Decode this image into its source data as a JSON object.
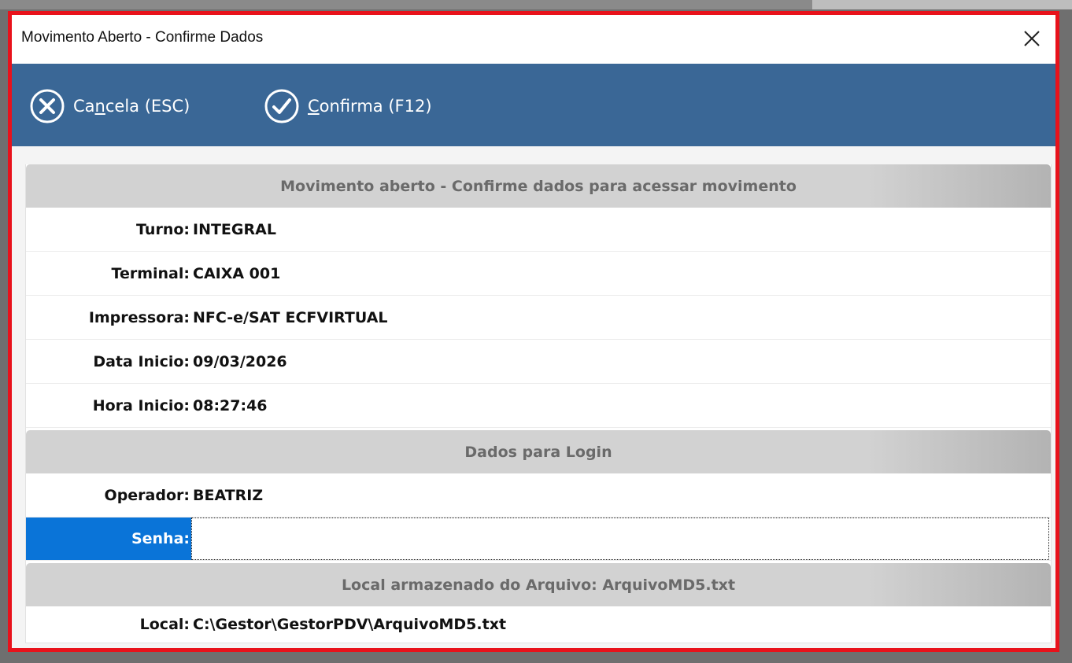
{
  "window": {
    "title": "Movimento Aberto - Confirme Dados"
  },
  "toolbar": {
    "cancel": {
      "label_pre": "Ca",
      "label_key": "n",
      "label_post": "cela (ESC)",
      "icon": "cancel-circle-icon"
    },
    "confirm": {
      "label_pre": "",
      "label_key": "C",
      "label_post": "onfirma (F12)",
      "icon": "check-circle-icon"
    }
  },
  "section_movimento": {
    "title": "Movimento aberto - Confirme dados para acessar movimento",
    "rows": [
      {
        "label": "Turno:",
        "value": "INTEGRAL"
      },
      {
        "label": "Terminal:",
        "value": "CAIXA 001"
      },
      {
        "label": "Impressora:",
        "value": "NFC-e/SAT ECFVIRTUAL"
      },
      {
        "label": "Data Inicio:",
        "value": "09/03/2026"
      },
      {
        "label": "Hora Inicio:",
        "value": "08:27:46"
      }
    ]
  },
  "section_login": {
    "title": "Dados para Login",
    "operador": {
      "label": "Operador:",
      "value": "BEATRIZ"
    },
    "senha": {
      "label": "Senha:",
      "value": ""
    }
  },
  "section_arquivo": {
    "title": "Local armazenado do Arquivo: ArquivoMD5.txt",
    "local": {
      "label": "Local:",
      "value": "C:\\Gestor\\GestorPDV\\ArquivoMD5.txt"
    }
  },
  "colors": {
    "toolbar_bg": "#3a6796",
    "active_label_bg": "#0a74d8",
    "window_border": "#e8121b",
    "section_header_bg": "#d2d2d2"
  }
}
